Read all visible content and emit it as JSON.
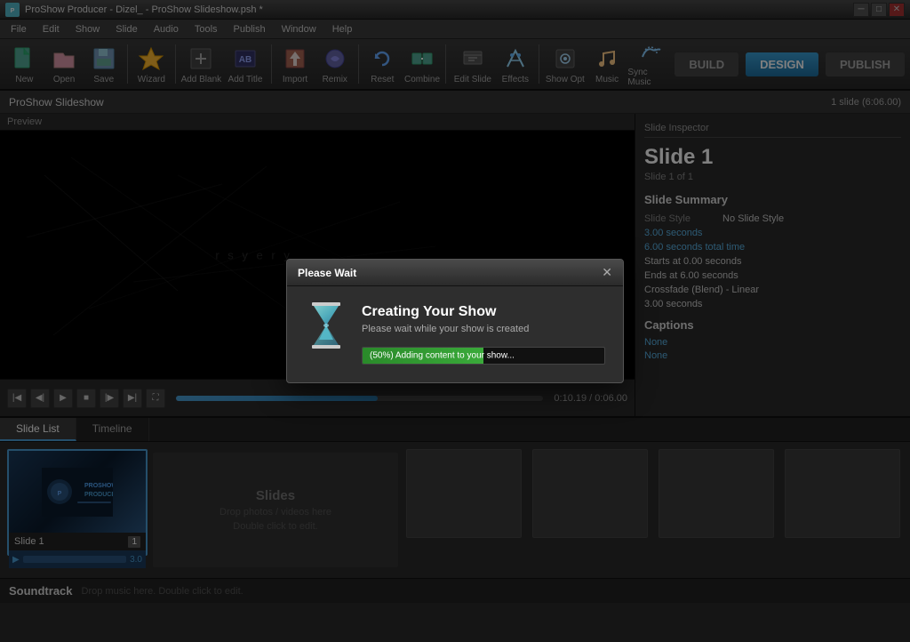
{
  "titlebar": {
    "title": "ProShow Producer - Dizel_ - ProShow Slideshow.psh *",
    "icon": "PS"
  },
  "menubar": {
    "items": [
      "File",
      "Edit",
      "Show",
      "Slide",
      "Audio",
      "Tools",
      "Publish",
      "Window",
      "Help"
    ]
  },
  "toolbar": {
    "buttons": [
      {
        "id": "new",
        "label": "New"
      },
      {
        "id": "open",
        "label": "Open"
      },
      {
        "id": "save",
        "label": "Save"
      },
      {
        "id": "wizard",
        "label": "Wizard"
      },
      {
        "id": "add-blank",
        "label": "Add Blank"
      },
      {
        "id": "add-title",
        "label": "Add Title"
      },
      {
        "id": "import",
        "label": "Import"
      },
      {
        "id": "remix",
        "label": "Remix"
      },
      {
        "id": "reset",
        "label": "Reset"
      },
      {
        "id": "combine",
        "label": "Combine"
      },
      {
        "id": "edit-slide",
        "label": "Edit Slide"
      },
      {
        "id": "effects",
        "label": "Effects"
      },
      {
        "id": "show-opt",
        "label": "Show Opt"
      },
      {
        "id": "music",
        "label": "Music"
      },
      {
        "id": "sync-music",
        "label": "Sync Music"
      }
    ],
    "build": "BUILD",
    "design": "DESIGN",
    "publish": "PUBLISH"
  },
  "projectbar": {
    "name": "ProShow Slideshow",
    "slide_count": "1 slide (6:06.00)"
  },
  "preview": {
    "label": "Preview",
    "watermark": "r s y e r y",
    "time": "0:10.19 / 0:06.00"
  },
  "inspector": {
    "label": "Slide Inspector",
    "slide_title": "Slide 1",
    "slide_sub": "Slide 1 of 1",
    "summary_label": "Slide Summary",
    "slide_style_key": "Slide Style",
    "slide_style_val": "No Slide Style",
    "time1": "3.00 seconds",
    "time2": "6.00 seconds total time",
    "starts": "Starts at 0.00 seconds",
    "ends": "Ends at 6.00 seconds",
    "transition": "Crossfade (Blend) - Linear",
    "trans_time": "3.00 seconds",
    "captions_label": "Captions",
    "caption1": "None",
    "caption2": "None"
  },
  "tabs": {
    "slide_list": "Slide List",
    "timeline": "Timeline"
  },
  "slide_list": {
    "slide1_name": "Slide 1",
    "slide1_num": "1",
    "slide1_duration": "3.0",
    "drop_label": "Slides",
    "drop_hint1": "Drop photos / videos here",
    "drop_hint2": "Double click to edit."
  },
  "soundtrack": {
    "label": "Soundtrack",
    "hint": "Drop music here. Double click to edit."
  },
  "modal": {
    "title": "Please Wait",
    "creating": "Creating Your Show",
    "subtext": "Please wait while your show is created",
    "progress_text": "(50%) Adding content to your show...",
    "progress_pct": 50
  }
}
